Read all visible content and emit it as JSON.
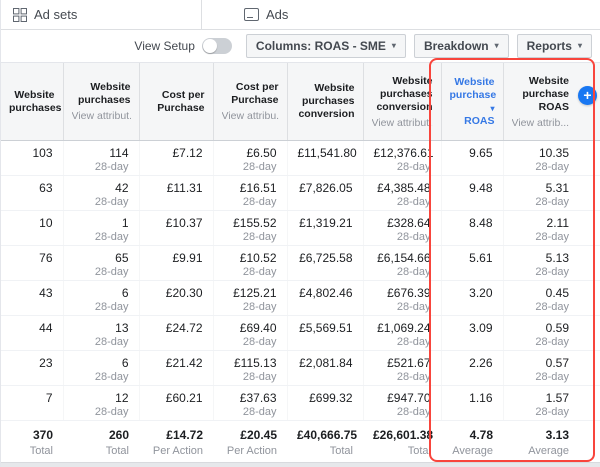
{
  "tabs": {
    "ad_sets": "Ad sets",
    "ads": "Ads"
  },
  "toolbar": {
    "view_setup": "View Setup",
    "columns": "Columns: ROAS - SME",
    "breakdown": "Breakdown",
    "reports": "Reports",
    "caret_icon": "▾"
  },
  "add_column_icon": "+",
  "colors": {
    "accent_blue": "#3578e5",
    "plus_button_blue": "#1877f2",
    "annotation_red": "#f8453c"
  },
  "table": {
    "attribution_window": "28-day",
    "sort_caret": "▾",
    "columns": [
      {
        "title": "Website purchases",
        "title2": "",
        "sub": "",
        "sorted": false,
        "highlight": false
      },
      {
        "title": "Website purchases",
        "title2": "",
        "sub": "View attribut...",
        "sorted": false,
        "highlight": false
      },
      {
        "title": "Cost per Purchase",
        "title2": "",
        "sub": "",
        "sorted": false,
        "highlight": false
      },
      {
        "title": "Cost per Purchase",
        "title2": "",
        "sub": "View attribu...",
        "sorted": false,
        "highlight": false
      },
      {
        "title": "Website purchases conversion",
        "title2": "",
        "sub": "",
        "sorted": false,
        "highlight": false
      },
      {
        "title": "Website purchases conversion",
        "title2": "",
        "sub": "View attribut...",
        "sorted": false,
        "highlight": false
      },
      {
        "title": "Website purchase",
        "title2": "ROAS",
        "sub": "",
        "sorted": true,
        "highlight": true
      },
      {
        "title": "Website purchase ROAS",
        "title2": "",
        "sub": "View attrib...",
        "sorted": false,
        "highlight": true
      }
    ],
    "rows": [
      [
        "103",
        "114",
        "£7.12",
        "£6.50",
        "£11,541.80",
        "£12,376.61",
        "9.65",
        "10.35"
      ],
      [
        "63",
        "42",
        "£11.31",
        "£16.51",
        "£7,826.05",
        "£4,385.48",
        "9.48",
        "5.31"
      ],
      [
        "10",
        "1",
        "£10.37",
        "£155.52",
        "£1,319.21",
        "£328.64",
        "8.48",
        "2.11"
      ],
      [
        "76",
        "65",
        "£9.91",
        "£10.52",
        "£6,725.58",
        "£6,154.66",
        "5.61",
        "5.13"
      ],
      [
        "43",
        "6",
        "£20.30",
        "£125.21",
        "£4,802.46",
        "£676.39",
        "3.20",
        "0.45"
      ],
      [
        "44",
        "13",
        "£24.72",
        "£69.40",
        "£5,569.51",
        "£1,069.24",
        "3.09",
        "0.59"
      ],
      [
        "23",
        "6",
        "£21.42",
        "£115.13",
        "£2,081.84",
        "£521.67",
        "2.26",
        "0.57"
      ],
      [
        "7",
        "12",
        "£60.21",
        "£37.63",
        "£699.32",
        "£947.70",
        "1.16",
        "1.57"
      ]
    ],
    "footer": {
      "values": [
        "370",
        "260",
        "£14.72",
        "£20.45",
        "£40,666.75",
        "£26,601.38",
        "4.78",
        "3.13"
      ],
      "labels": [
        "Total",
        "Total",
        "Per Action",
        "Per Action",
        "Total",
        "Total",
        "Average",
        "Average"
      ]
    }
  }
}
